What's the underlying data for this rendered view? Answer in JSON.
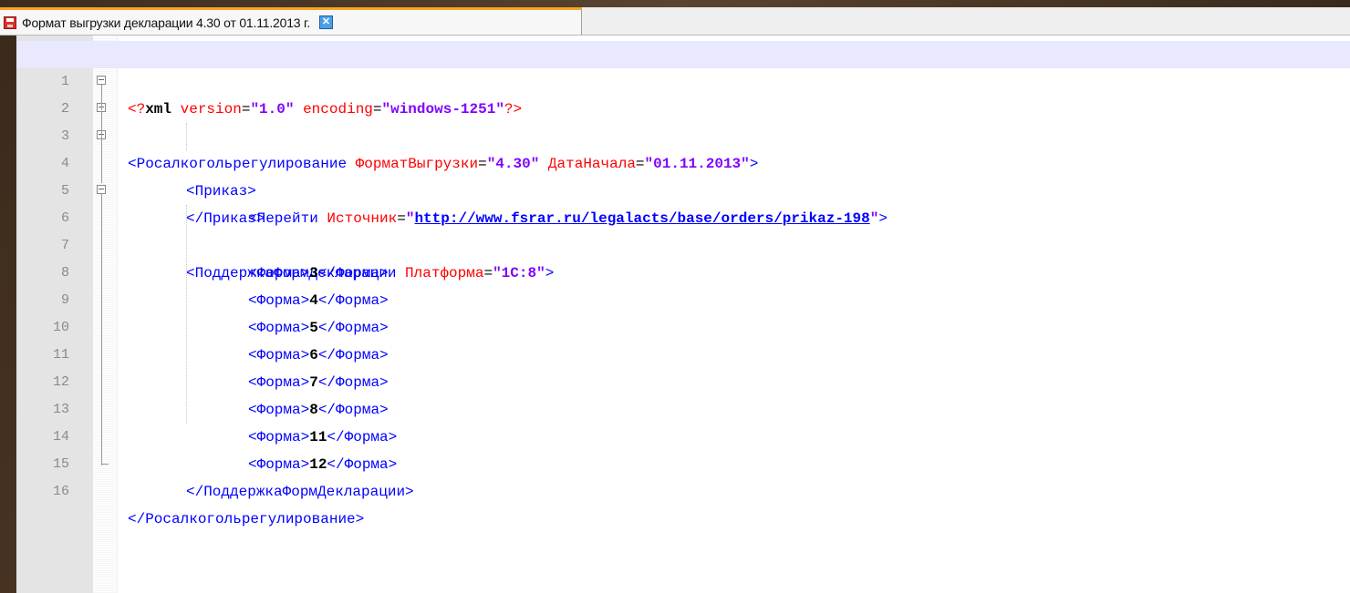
{
  "tab": {
    "title": "Формат выгрузки декларации 4.30 от 01.11.2013 г.",
    "close_glyph": "✕"
  },
  "lines": [
    {
      "num": "1"
    },
    {
      "num": "2"
    },
    {
      "num": "3"
    },
    {
      "num": "4"
    },
    {
      "num": "5"
    },
    {
      "num": "6"
    },
    {
      "num": "7"
    },
    {
      "num": "8"
    },
    {
      "num": "9"
    },
    {
      "num": "10"
    },
    {
      "num": "11"
    },
    {
      "num": "12"
    },
    {
      "num": "13"
    },
    {
      "num": "14"
    },
    {
      "num": "15"
    },
    {
      "num": "16"
    }
  ],
  "code": {
    "l1": {
      "open": "<?",
      "xml": "xml",
      "sp1": " ",
      "a1": "version",
      "eq1": "=",
      "v1": "\"1.0\"",
      "sp2": " ",
      "a2": "encoding",
      "eq2": "=",
      "v2": "\"windows-1251\"",
      "close": "?>"
    },
    "l2": {
      "tag": "<Росалкогольрегулирование",
      "a1": "ФорматВыгрузки",
      "v1": "\"4.30\"",
      "a2": "ДатаНачала",
      "v2": "\"01.11.2013\"",
      "close": ">"
    },
    "l3": {
      "tag": "<Приказ>"
    },
    "l4": {
      "tag": "<Перейти",
      "a1": "Источник",
      "q1": "\"",
      "link": "http://www.fsrar.ru/legalacts/base/orders/prikaz-198",
      "q2": "\"",
      "close": ">"
    },
    "l5": {
      "tag": "</Приказ>"
    },
    "l6": {
      "tag": "<ПоддержкаФормДекларации",
      "a1": "Платформа",
      "v1": "\"1C:8\"",
      "close": ">"
    },
    "forms": [
      {
        "open": "<Форма>",
        "value": "3",
        "close": "</Форма>"
      },
      {
        "open": "<Форма>",
        "value": "4",
        "close": "</Форма>"
      },
      {
        "open": "<Форма>",
        "value": "5",
        "close": "</Форма>"
      },
      {
        "open": "<Форма>",
        "value": "6",
        "close": "</Форма>"
      },
      {
        "open": "<Форма>",
        "value": "7",
        "close": "</Форма>"
      },
      {
        "open": "<Форма>",
        "value": "8",
        "close": "</Форма>"
      },
      {
        "open": "<Форма>",
        "value": "11",
        "close": "</Форма>"
      },
      {
        "open": "<Форма>",
        "value": "12",
        "close": "</Форма>"
      }
    ],
    "l15": {
      "tag": "</ПоддержкаФормДекларации>"
    },
    "l16": {
      "tag": "</Росалкогольрегулирование>"
    }
  },
  "colors": {
    "tag": "#0000ff",
    "attribute": "#ff0000",
    "value": "#8000ff",
    "tab_accent": "#f6a623",
    "current_line": "#e8e8ff"
  }
}
